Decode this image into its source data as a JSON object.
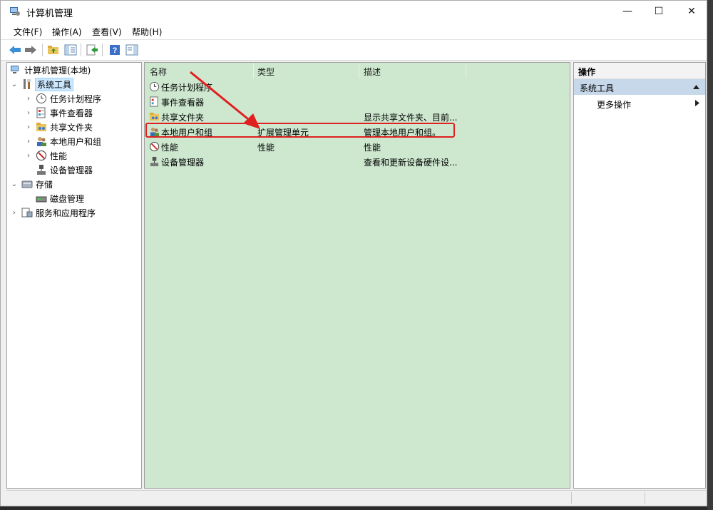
{
  "window": {
    "title": "计算机管理",
    "min": "—",
    "max": "☐",
    "close": "✕"
  },
  "menu": [
    "文件(F)",
    "操作(A)",
    "查看(V)",
    "帮助(H)"
  ],
  "toolbar": [
    "back-icon",
    "forward-icon",
    "up-folder-icon",
    "show-tree-icon",
    "export-icon",
    "help-icon",
    "show-action-pane-icon"
  ],
  "tree": {
    "root": "计算机管理(本地)",
    "system_tools": "系统工具",
    "task_scheduler": "任务计划程序",
    "event_viewer": "事件查看器",
    "shared_folders": "共享文件夹",
    "local_users": "本地用户和组",
    "performance": "性能",
    "device_manager": "设备管理器",
    "storage": "存储",
    "disk_management": "磁盘管理",
    "services_apps": "服务和应用程序"
  },
  "list": {
    "columns": [
      "名称",
      "类型",
      "描述"
    ],
    "rows": [
      {
        "name": "任务计划程序",
        "type": "",
        "desc": ""
      },
      {
        "name": "事件查看器",
        "type": "",
        "desc": ""
      },
      {
        "name": "共享文件夹",
        "type": "",
        "desc": "显示共享文件夹、目前..."
      },
      {
        "name": "本地用户和组",
        "type": "扩展管理单元",
        "desc": "管理本地用户和组。"
      },
      {
        "name": "性能",
        "type": "性能",
        "desc": "性能"
      },
      {
        "name": "设备管理器",
        "type": "",
        "desc": "查看和更新设备硬件设..."
      }
    ]
  },
  "actions": {
    "header": "操作",
    "section": "系统工具",
    "more": "更多操作"
  },
  "colors": {
    "list_bg": "#cde8cf",
    "highlight": "#e02020",
    "arrow": "#e02020"
  }
}
